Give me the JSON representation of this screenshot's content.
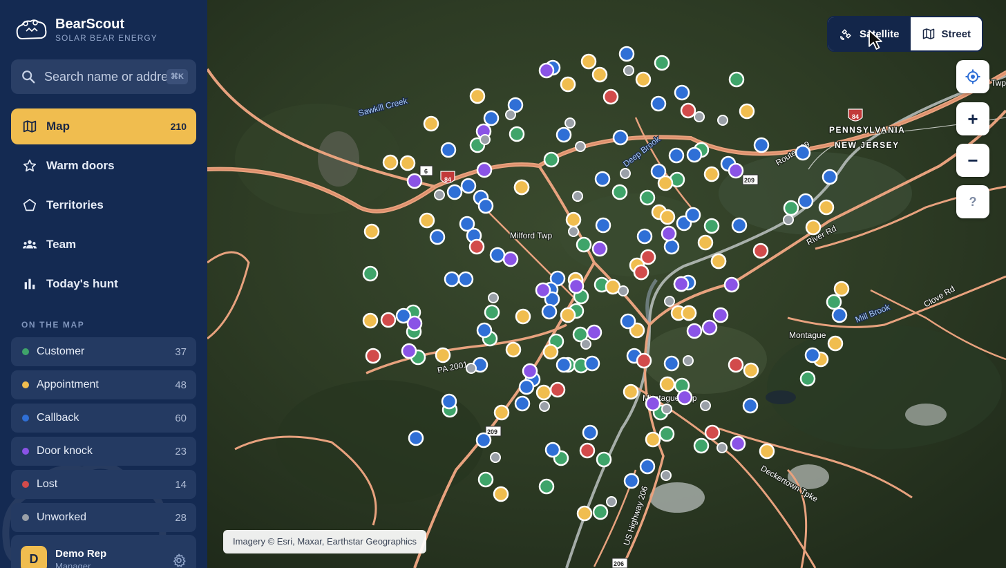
{
  "brand": {
    "name": "BearScout",
    "subtitle": "SOLAR BEAR ENERGY"
  },
  "search": {
    "placeholder": "Search name or address",
    "shortcut": "⌘K"
  },
  "nav": [
    {
      "id": "map",
      "label": "Map",
      "count": "210",
      "icon": "map-icon",
      "active": true
    },
    {
      "id": "warm-doors",
      "label": "Warm doors",
      "count": "",
      "icon": "star-icon",
      "active": false
    },
    {
      "id": "territories",
      "label": "Territories",
      "count": "",
      "icon": "pentagon-icon",
      "active": false
    },
    {
      "id": "team",
      "label": "Team",
      "count": "",
      "icon": "users-icon",
      "active": false
    },
    {
      "id": "todays-hunt",
      "label": "Today's hunt",
      "count": "",
      "icon": "bar-chart-icon",
      "active": false
    }
  ],
  "on_the_map": {
    "title": "ON THE MAP",
    "items": [
      {
        "label": "Customer",
        "count": "37",
        "color": "#3fa46a"
      },
      {
        "label": "Appointment",
        "count": "48",
        "color": "#f0bd4f"
      },
      {
        "label": "Callback",
        "count": "60",
        "color": "#2f6fd6"
      },
      {
        "label": "Door knock",
        "count": "23",
        "color": "#8a53e6"
      },
      {
        "label": "Lost",
        "count": "14",
        "color": "#d24b4b"
      },
      {
        "label": "Unworked",
        "count": "28",
        "color": "#9aa0a8"
      }
    ]
  },
  "user": {
    "initial": "D",
    "name": "Demo Rep",
    "role": "Manager"
  },
  "map": {
    "layer_toggle": {
      "satellite": "Satellite",
      "street": "Street",
      "active": "satellite"
    },
    "controls": {
      "zoom_in": "+",
      "zoom_out": "−",
      "help": "?"
    },
    "attribution": "Imagery © Esri, Maxar, Earthstar Geographics",
    "labels": {
      "milford": "Milford Twp",
      "montague": "Montague",
      "montague_twp": "Montague Twp",
      "pennsylvania": "PENNSYLVANIA",
      "new_jersey": "NEW JERSEY",
      "sawkill": "Sawkill Creek",
      "deep_brook": "Deep Brook",
      "mill_brook": "Mill Brook",
      "river_rd": "River Rd",
      "clove_rd": "Clove Rd",
      "route_209": "Route 209",
      "pa2001": "PA 2001",
      "us206": "US Highway 206",
      "deckertown": "Deckertown Tpke",
      "twp": "Twp",
      "i84": "84",
      "r6": "6",
      "r209": "209",
      "r206": "206"
    },
    "pin_colors": {
      "customer": "#3fa46a",
      "appointment": "#f0bd4f",
      "callback": "#2f6fd6",
      "door_knock": "#8a53e6",
      "lost": "#d24b4b",
      "unworked": "#9aa0a8"
    }
  }
}
